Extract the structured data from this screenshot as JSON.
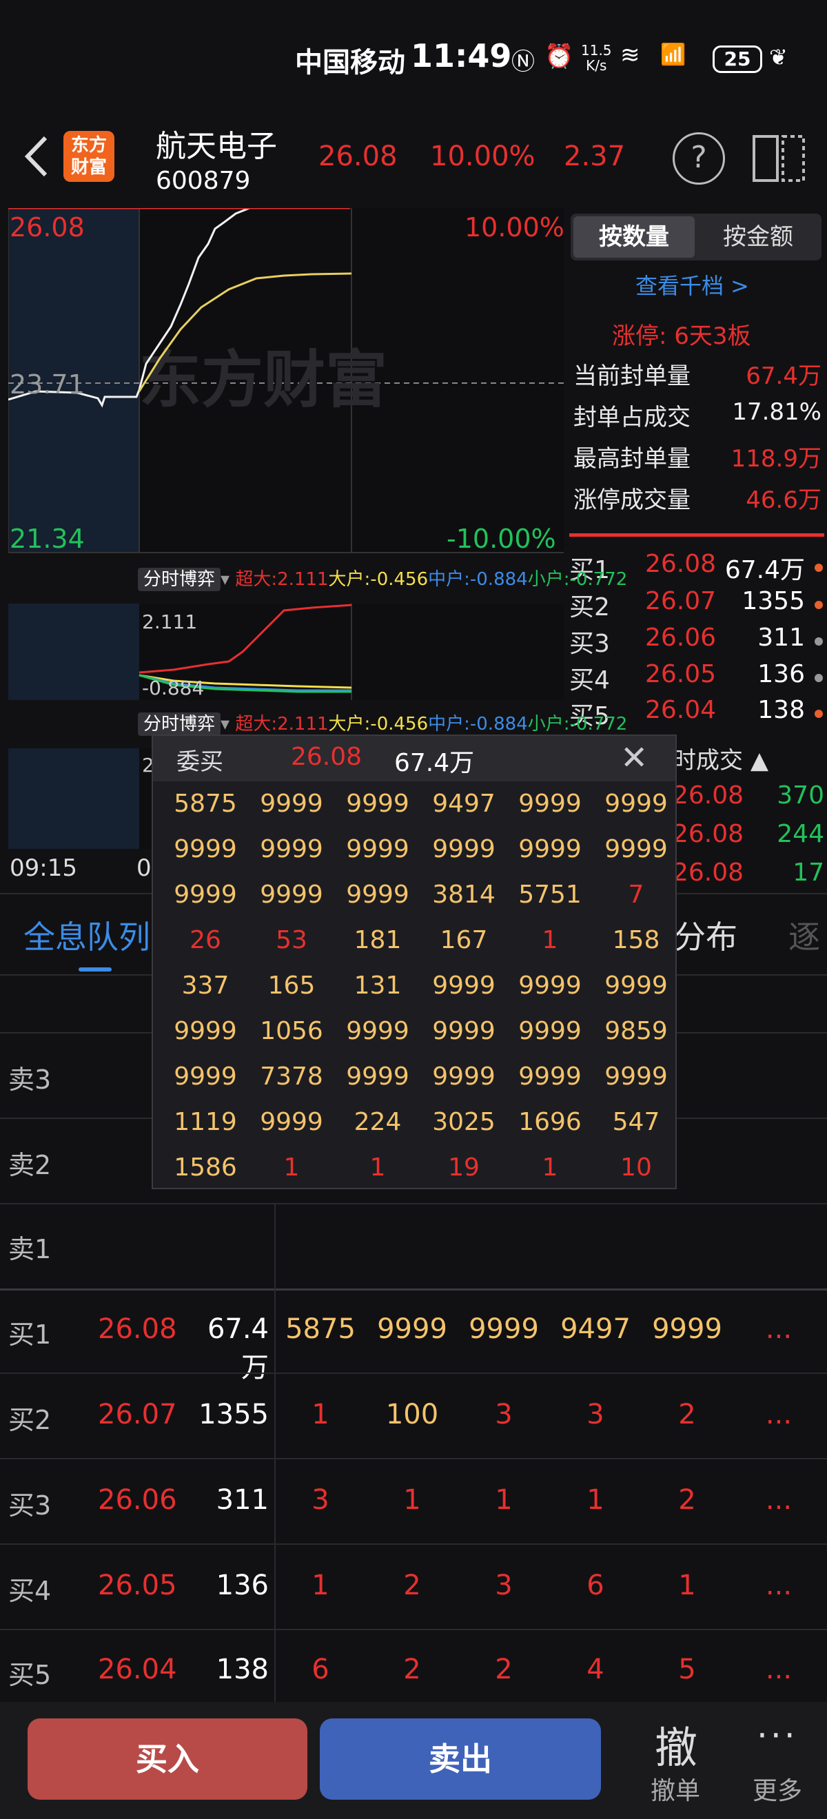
{
  "status": {
    "carrier": "中国移动",
    "time": "11:49",
    "speed_top": "11.5",
    "speed_unit": "K/s",
    "battery": "25"
  },
  "header": {
    "name": "航天电子",
    "code": "600879",
    "price": "26.08",
    "pct": "10.00%",
    "change": "2.37",
    "logo_line1": "东方",
    "logo_line2": "财富"
  },
  "chart": {
    "high_label": "26.08",
    "pct_high": "10.00%",
    "mid_label": "23.71",
    "low_label": "21.34",
    "pct_low": "-10.00%",
    "watermark": "东方财富",
    "time_start": "09:15",
    "time_second": "0"
  },
  "right_panel": {
    "tab_volume": "按数量",
    "tab_amount": "按金额",
    "view_thousand": "查看千档 >",
    "limit_up": "涨停:  6天3板",
    "stats": [
      {
        "label": "当前封单量",
        "value": "67.4万",
        "color": "red"
      },
      {
        "label": "封单占成交",
        "value": "17.81%",
        "color": "white"
      },
      {
        "label": "最高封单量",
        "value": "118.9万",
        "color": "red"
      },
      {
        "label": "涨停成交量",
        "value": "46.6万",
        "color": "red"
      }
    ],
    "orderbook": [
      {
        "label": "买1",
        "price": "26.08",
        "qty": "67.4万",
        "dot": "#e8602e"
      },
      {
        "label": "买2",
        "price": "26.07",
        "qty": "1355",
        "dot": "#e8602e"
      },
      {
        "label": "买3",
        "price": "26.06",
        "qty": "311",
        "dot": "#999999"
      },
      {
        "label": "买4",
        "price": "26.05",
        "qty": "136",
        "dot": "#999999"
      },
      {
        "label": "买5",
        "price": "26.04",
        "qty": "138",
        "dot": "#e8602e"
      }
    ],
    "trades_header": "时成交",
    "trades": [
      {
        "price": "26.08",
        "qty": "370"
      },
      {
        "price": "26.08",
        "qty": "244"
      },
      {
        "price": "26.08",
        "qty": "17"
      }
    ]
  },
  "indicator": {
    "tag": "分时博弈",
    "super": "超大:2.111",
    "large": "大户:-0.456",
    "medium": "中户:-0.884",
    "small": "小户:-0.772",
    "top_value": "2.111",
    "bottom_value": "-0.884",
    "sub2_value": "2"
  },
  "tabs": {
    "full_queue": "全息队列",
    "distribution": "分布",
    "more": "逐"
  },
  "sell_rows": [
    "卖3",
    "卖2",
    "卖1"
  ],
  "buy_rows": [
    {
      "label": "买1",
      "price": "26.08",
      "vol": "67.4万",
      "cells": [
        "5875",
        "9999",
        "9999",
        "9497",
        "9999"
      ],
      "gold": true
    },
    {
      "label": "买2",
      "price": "26.07",
      "vol": "1355",
      "cells": [
        "1",
        "100",
        "3",
        "3",
        "2"
      ],
      "gold": false
    },
    {
      "label": "买3",
      "price": "26.06",
      "vol": "311",
      "cells": [
        "3",
        "1",
        "1",
        "1",
        "2"
      ],
      "gold": false
    },
    {
      "label": "买4",
      "price": "26.05",
      "vol": "136",
      "cells": [
        "1",
        "2",
        "3",
        "6",
        "1"
      ],
      "gold": false
    },
    {
      "label": "买5",
      "price": "26.04",
      "vol": "138",
      "cells": [
        "6",
        "2",
        "2",
        "4",
        "5"
      ],
      "gold": false
    }
  ],
  "ellipsis": "...",
  "popup": {
    "title": "委买",
    "price": "26.08",
    "qty": "67.4万",
    "rows": [
      [
        "5875",
        "9999",
        "9999",
        "9497",
        "9999",
        "9999"
      ],
      [
        "9999",
        "9999",
        "9999",
        "9999",
        "9999",
        "9999"
      ],
      [
        "9999",
        "9999",
        "9999",
        "3814",
        "5751",
        "7"
      ],
      [
        "26",
        "53",
        "181",
        "167",
        "1",
        "158"
      ],
      [
        "337",
        "165",
        "131",
        "9999",
        "9999",
        "9999"
      ],
      [
        "9999",
        "1056",
        "9999",
        "9999",
        "9999",
        "9859"
      ],
      [
        "9999",
        "7378",
        "9999",
        "9999",
        "9999",
        "9999"
      ],
      [
        "1119",
        "9999",
        "224",
        "3025",
        "1696",
        "547"
      ],
      [
        "1586",
        "1",
        "1",
        "19",
        "1",
        "10"
      ]
    ],
    "red_cells": [
      [
        2,
        5
      ],
      [
        3,
        0
      ],
      [
        3,
        1
      ],
      [
        3,
        4
      ],
      [
        8,
        1
      ],
      [
        8,
        2
      ],
      [
        8,
        3
      ],
      [
        8,
        4
      ],
      [
        8,
        5
      ]
    ]
  },
  "bottom": {
    "buy": "买入",
    "sell": "卖出",
    "cancel_icon": "撤",
    "cancel": "撤单",
    "more_icon": "···",
    "more": "更多"
  }
}
